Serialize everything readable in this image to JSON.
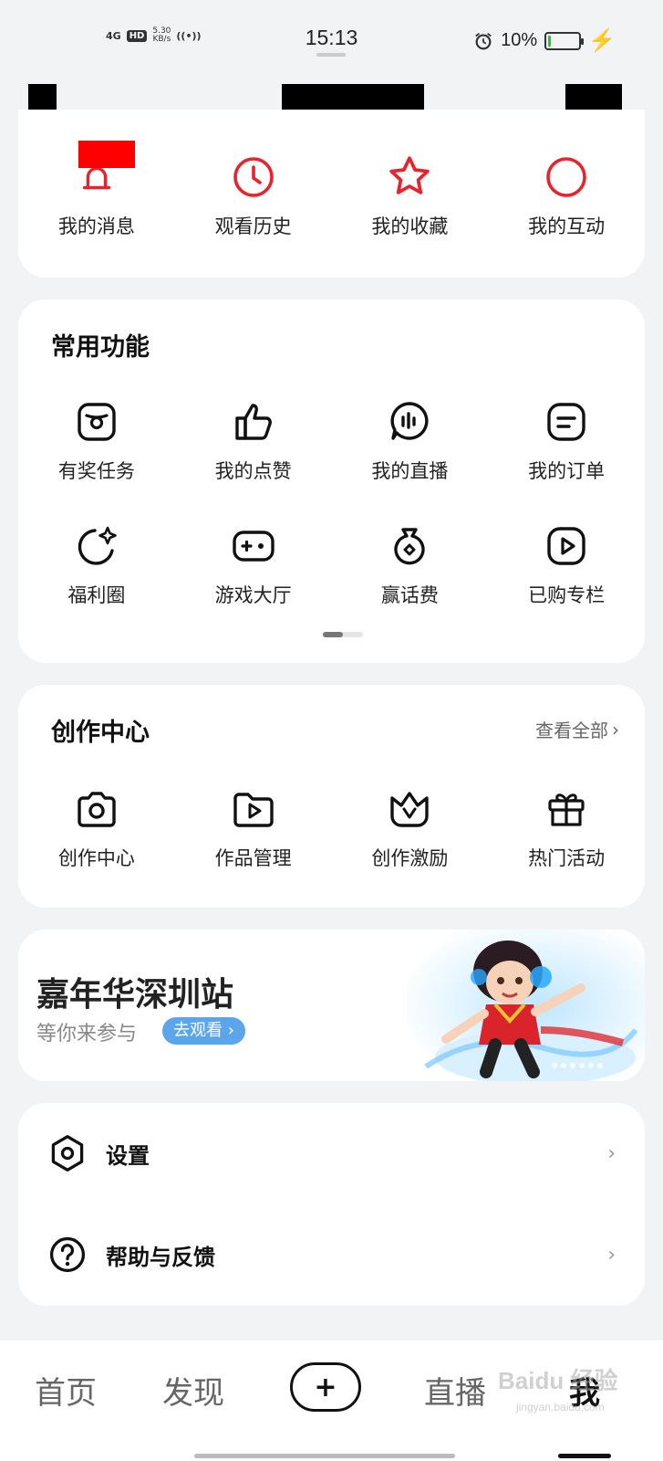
{
  "status_bar": {
    "network": "4G",
    "hd": "HD",
    "speed_value": "5.30",
    "speed_unit": "KB/s",
    "time": "15:13",
    "battery_text": "10%",
    "battery_level": 0.1
  },
  "quick_actions": [
    {
      "label": "我的消息",
      "icon": "bell-icon"
    },
    {
      "label": "观看历史",
      "icon": "clock-icon"
    },
    {
      "label": "我的收藏",
      "icon": "star-icon"
    },
    {
      "label": "我的互动",
      "icon": "circle-icon"
    }
  ],
  "common_functions": {
    "title": "常用功能",
    "row1": [
      {
        "label": "有奖任务",
        "icon": "reward-task-icon"
      },
      {
        "label": "我的点赞",
        "icon": "thumbs-up-icon"
      },
      {
        "label": "我的直播",
        "icon": "live-icon"
      },
      {
        "label": "我的订单",
        "icon": "order-icon"
      }
    ],
    "row2": [
      {
        "label": "福利圈",
        "icon": "welfare-icon"
      },
      {
        "label": "游戏大厅",
        "icon": "gamepad-icon"
      },
      {
        "label": "赢话费",
        "icon": "money-bag-icon"
      },
      {
        "label": "已购专栏",
        "icon": "purchased-column-icon"
      }
    ]
  },
  "creation_center": {
    "title": "创作中心",
    "view_all": "查看全部",
    "items": [
      {
        "label": "创作中心",
        "icon": "camera-icon"
      },
      {
        "label": "作品管理",
        "icon": "folder-play-icon"
      },
      {
        "label": "创作激励",
        "icon": "crown-icon"
      },
      {
        "label": "热门活动",
        "icon": "gift-icon"
      }
    ]
  },
  "banner": {
    "title": "嘉年华深圳站",
    "subtitle": "等你来参与",
    "button": "去观看"
  },
  "settings_list": [
    {
      "label": "设置",
      "icon": "settings-icon"
    },
    {
      "label": "帮助与反馈",
      "icon": "help-icon"
    }
  ],
  "bottom_nav": {
    "home": "首页",
    "discover": "发现",
    "live": "直播",
    "me": "我"
  },
  "colors": {
    "accent_red": "#e8232c",
    "background": "#f2f3f5",
    "banner_button": "#5ba6ea"
  }
}
